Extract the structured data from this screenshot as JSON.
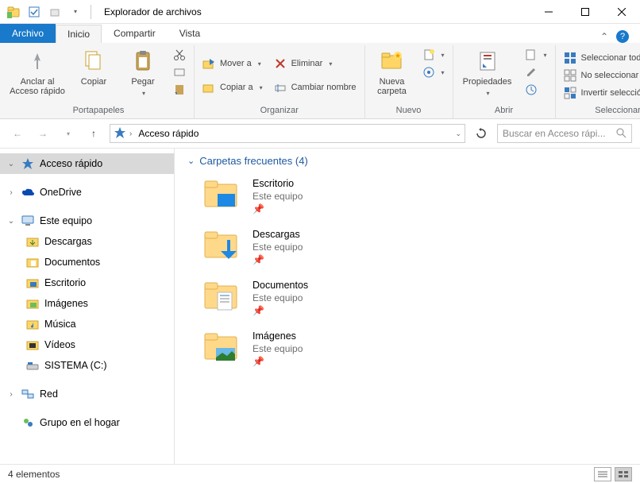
{
  "window": {
    "title": "Explorador de archivos"
  },
  "tabs": {
    "file": "Archivo",
    "home": "Inicio",
    "share": "Compartir",
    "view": "Vista"
  },
  "ribbon": {
    "clipboard": {
      "pin": "Anclar al Acceso rápido",
      "copy": "Copiar",
      "paste": "Pegar",
      "label": "Portapapeles"
    },
    "organize": {
      "move": "Mover a",
      "delete": "Eliminar",
      "copyto": "Copiar a",
      "rename": "Cambiar nombre",
      "label": "Organizar"
    },
    "new": {
      "newfolder": "Nueva carpeta",
      "label": "Nuevo"
    },
    "open": {
      "properties": "Propiedades",
      "label": "Abrir"
    },
    "select": {
      "all": "Seleccionar todo",
      "none": "No seleccionar ninguno",
      "invert": "Invertir selección",
      "label": "Seleccionar"
    }
  },
  "addressbar": {
    "location": "Acceso rápido"
  },
  "search": {
    "placeholder": "Buscar en Acceso rápi..."
  },
  "tree": {
    "quick": "Acceso rápido",
    "onedrive": "OneDrive",
    "thispc": "Este equipo",
    "downloads": "Descargas",
    "documents": "Documentos",
    "desktop": "Escritorio",
    "pictures": "Imágenes",
    "music": "Música",
    "videos": "Vídeos",
    "system": "SISTEMA (C:)",
    "network": "Red",
    "homegroup": "Grupo en el hogar"
  },
  "main": {
    "header": "Carpetas frecuentes (4)",
    "items": [
      {
        "name": "Escritorio",
        "location": "Este equipo"
      },
      {
        "name": "Descargas",
        "location": "Este equipo"
      },
      {
        "name": "Documentos",
        "location": "Este equipo"
      },
      {
        "name": "Imágenes",
        "location": "Este equipo"
      }
    ]
  },
  "status": {
    "count": "4 elementos"
  }
}
